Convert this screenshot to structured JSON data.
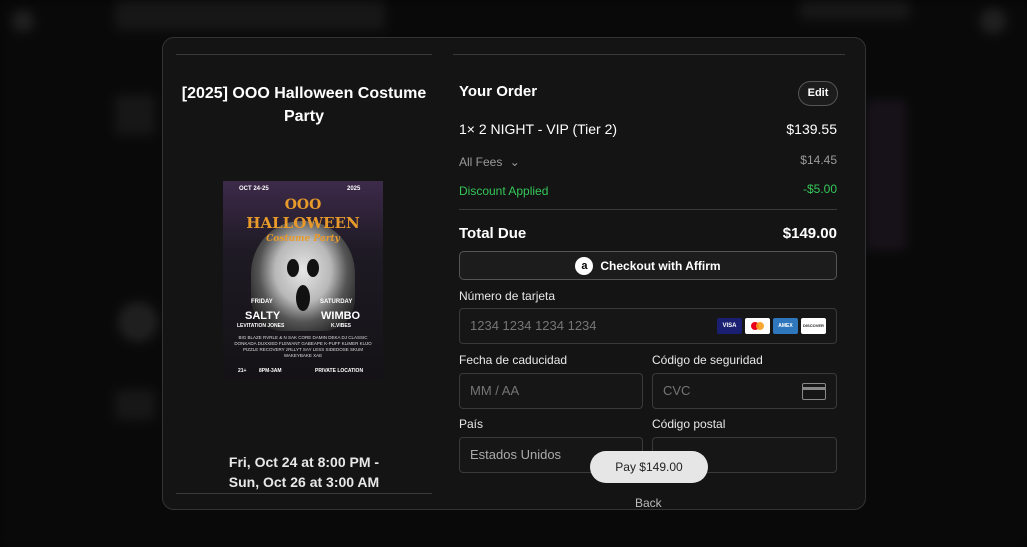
{
  "event": {
    "title": "[2025] OOO Halloween Costume Party",
    "date_line1": "Fri, Oct 24 at 8:00 PM -",
    "date_line2": "Sun, Oct 26 at 3:00 AM",
    "poster": {
      "dates": "OCT 24-25",
      "year": "2025",
      "ooo": "OOO",
      "halloween": "HALLOWEEN",
      "subtitle": "Costume Party",
      "day1": "FRIDAY",
      "day2": "SATURDAY",
      "headliner1": "SALTY",
      "headliner2": "WIMBO",
      "support1": "LEVITATION JONES",
      "support2": "K.VIBES",
      "lineup": "BIG BLAZE  RVRLE & N SAK  CORE  DAMIN  DEKA  DJ CLASSIC  DONKADA  DUXXIED  FLEWANT  GABEAPE  K-PUFF  KLIMER  KUJO  PIZZLE  RECOVERY  zRLLYT  SAY LESS  SIDEDOSE  SKUM  WAKEYBAKE  XAE",
      "age": "21+",
      "time": "8PM-3AM",
      "location": "PRIVATE LOCATION"
    }
  },
  "order": {
    "heading": "Your Order",
    "edit_label": "Edit",
    "item_label": "1× 2 NIGHT - VIP (Tier 2)",
    "item_price": "$139.55",
    "fees_label": "All Fees",
    "fees_value": "$14.45",
    "discount_label": "Discount Applied",
    "discount_value": "-$5.00",
    "total_label": "Total Due",
    "total_value": "$149.00"
  },
  "payment": {
    "affirm_label": "Checkout with Affirm",
    "card_number_label": "Número de tarjeta",
    "card_number_placeholder": "1234 1234 1234 1234",
    "card_brands": [
      "VISA",
      "MC",
      "AMEX",
      "DISCOVER"
    ],
    "expiry_label": "Fecha de caducidad",
    "expiry_placeholder": "MM / AA",
    "cvc_label": "Código de seguridad",
    "cvc_placeholder": "CVC",
    "country_label": "País",
    "country_value": "Estados Unidos",
    "postal_label": "Código postal",
    "pay_label": "Pay $149.00",
    "back_label": "Back"
  },
  "colors": {
    "accent_green": "#34c759",
    "poster_orange": "#e89a2a"
  }
}
